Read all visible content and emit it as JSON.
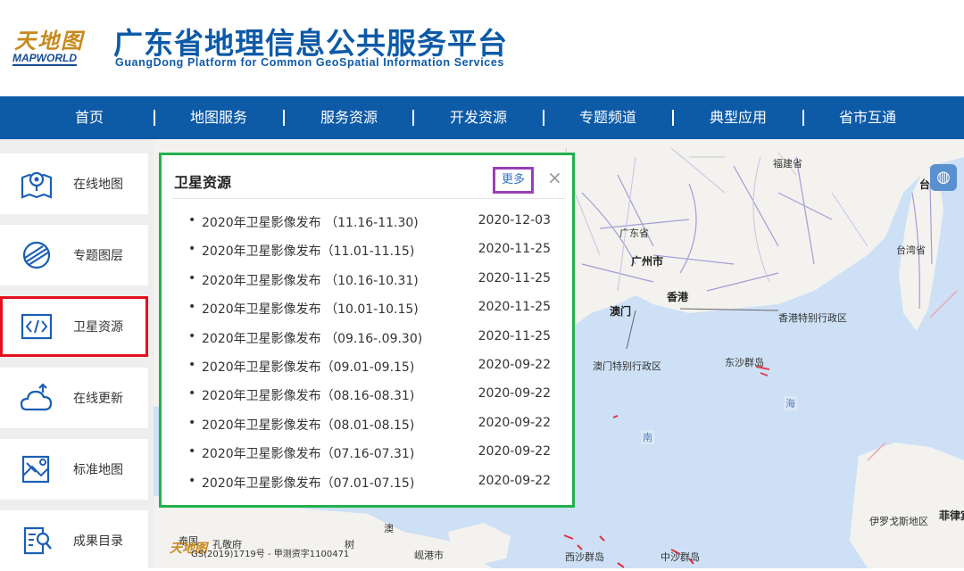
{
  "header": {
    "logo_cn": "天地图",
    "logo_en": "MAPWORLD",
    "title": "广东省地理信息公共服务平台",
    "subtitle": "GuangDong Platform for Common GeoSpatial Information Services"
  },
  "nav": {
    "items": [
      {
        "label": "首页"
      },
      {
        "label": "地图服务"
      },
      {
        "label": "服务资源"
      },
      {
        "label": "开发资源"
      },
      {
        "label": "专题频道"
      },
      {
        "label": "典型应用"
      },
      {
        "label": "省市互通"
      }
    ],
    "separator": "|"
  },
  "sidebar": {
    "items": [
      {
        "label": "在线地图",
        "icon": "map-pin-icon"
      },
      {
        "label": "专题图层",
        "icon": "layers-icon"
      },
      {
        "label": "卫星资源",
        "icon": "code-icon",
        "active": true
      },
      {
        "label": "在线更新",
        "icon": "cloud-upload-icon"
      },
      {
        "label": "标准地图",
        "icon": "standard-map-icon"
      },
      {
        "label": "成果目录",
        "icon": "catalog-search-icon"
      }
    ],
    "active_color": "#e3101e"
  },
  "panel": {
    "title": "卫星资源",
    "more_label": "更多",
    "close_label": "×",
    "bullet": "•",
    "items": [
      {
        "title": "2020年卫星影像发布 （11.16-11.30)",
        "date": "2020-12-03"
      },
      {
        "title": "2020年卫星影像发布（11.01-11.15)",
        "date": "2020-11-25"
      },
      {
        "title": "2020年卫星影像发布 （10.16-10.31)",
        "date": "2020-11-25"
      },
      {
        "title": "2020年卫星影像发布 （10.01-10.15)",
        "date": "2020-11-25"
      },
      {
        "title": "2020年卫星影像发布 （09.16-.09.30)",
        "date": "2020-11-25"
      },
      {
        "title": "2020年卫星影像发布（09.01-09.15)",
        "date": "2020-09-22"
      },
      {
        "title": "2020年卫星影像发布（08.16-08.31)",
        "date": "2020-09-22"
      },
      {
        "title": "2020年卫星影像发布（08.01-08.15)",
        "date": "2020-09-22"
      },
      {
        "title": "2020年卫星影像发布（07.16-07.31)",
        "date": "2020-09-22"
      },
      {
        "title": "2020年卫星影像发布（07.01-07.15)",
        "date": "2020-09-22"
      }
    ],
    "border_color": "#22b24c"
  },
  "map": {
    "labels": {
      "fujian": "福建省",
      "guangdong": "广东省",
      "guangzhou": "广州市",
      "hongkong": "香港",
      "macau": "澳门",
      "hk_sar": "香港特别行政区",
      "macau_sar": "澳门特别行政区",
      "dongsha": "东沙群岛",
      "taiwan_prov": "台湾省",
      "tai": "台",
      "sea_hai": "海",
      "sea_nan": "南",
      "thailand": "泰国",
      "kongjing": "孔敬府",
      "shu": "树",
      "ao": "澳",
      "tomb": "岘港市",
      "xisha": "西沙群岛",
      "zhongsha": "中沙群岛",
      "philippines": "菲律宾",
      "ivory": "伊罗戈斯地区"
    },
    "copyright_logo": "天地图",
    "copyright": "GS(2019)1719号 - 甲测资字1100471",
    "globe_icon": "globe-icon"
  }
}
